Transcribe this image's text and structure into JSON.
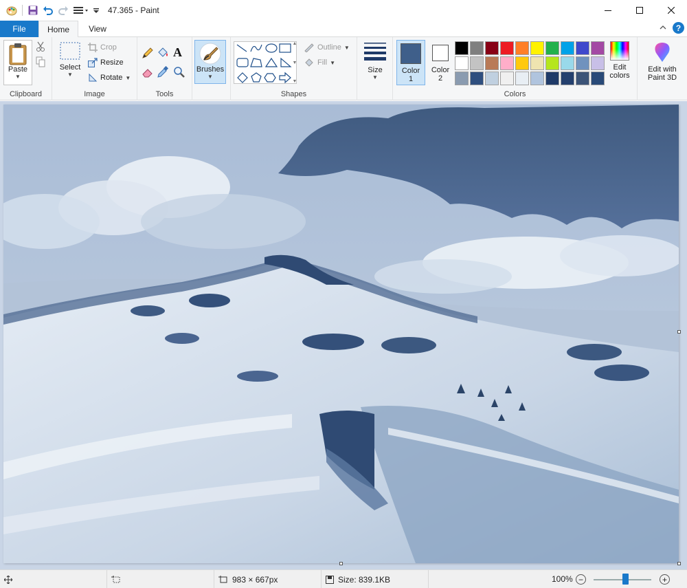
{
  "window": {
    "title": "47.365 - Paint"
  },
  "tabs": {
    "file": "File",
    "home": "Home",
    "view": "View"
  },
  "clipboard": {
    "group": "Clipboard",
    "paste": "Paste"
  },
  "image": {
    "group": "Image",
    "select": "Select",
    "crop": "Crop",
    "resize": "Resize",
    "rotate": "Rotate"
  },
  "tools": {
    "group": "Tools"
  },
  "brushes": {
    "label": "Brushes"
  },
  "shapes": {
    "group": "Shapes",
    "outline": "Outline",
    "fill": "Fill"
  },
  "size": {
    "label": "Size"
  },
  "colors": {
    "group": "Colors",
    "color1_label": "Color",
    "color1_num": "1",
    "color2_label": "Color",
    "color2_num": "2",
    "color1": "#3f5f8a",
    "color2": "#ffffff",
    "edit_colors_line1": "Edit",
    "edit_colors_line2": "colors",
    "palette": [
      "#000000",
      "#7f7f7f",
      "#880015",
      "#ed1c24",
      "#ff7f27",
      "#fff200",
      "#22b14c",
      "#00a2e8",
      "#3f48cc",
      "#a349a4",
      "#ffffff",
      "#c3c3c3",
      "#b97a57",
      "#ffaec9",
      "#ffc90e",
      "#efe4b0",
      "#b5e61d",
      "#99d9ea",
      "#7092be",
      "#c8bfe7",
      "#8a9bb0",
      "#2f4f7f",
      "#c0d0e0",
      "#f0f0f0",
      "#e8eef4",
      "#b0c4de",
      "#1f3a68",
      "#24406e",
      "#3c5478",
      "#294a78"
    ]
  },
  "paint3d": {
    "line1": "Edit with",
    "line2": "Paint 3D"
  },
  "status": {
    "dimensions": "983 × 667px",
    "size": "Size: 839.1KB",
    "zoom": "100%",
    "zoom_fraction": 0.55
  }
}
